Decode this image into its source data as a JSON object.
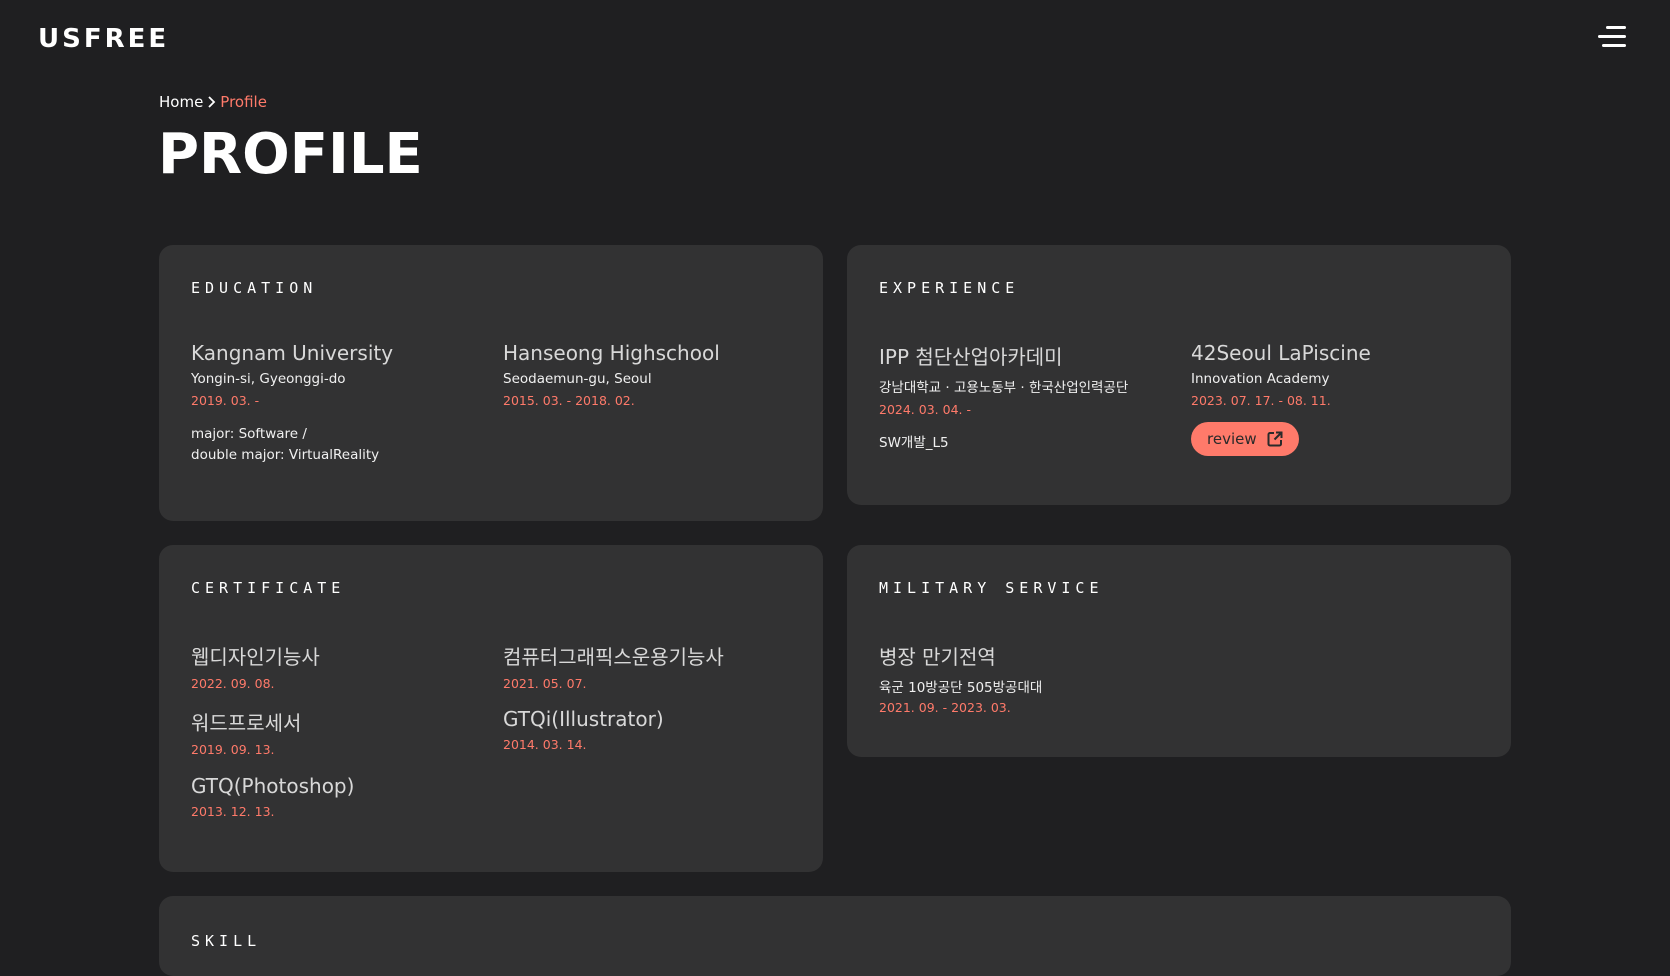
{
  "header": {
    "logo": "USFREE",
    "menu_icon": "hamburger-menu-icon"
  },
  "breadcrumb": {
    "home": "Home",
    "current": "Profile"
  },
  "page_title": "PROFILE",
  "education": {
    "title": "EDUCATION",
    "items": [
      {
        "name": "Kangnam University",
        "location": "Yongin-si, Gyeonggi-do",
        "date": "2019. 03. -",
        "note_line1": "major: Software /",
        "note_line2": "double major: VirtualReality"
      },
      {
        "name": "Hanseong Highschool",
        "location": "Seodaemun-gu, Seoul",
        "date": "2015. 03. - 2018. 02."
      }
    ]
  },
  "experience": {
    "title": "EXPERIENCE",
    "items": [
      {
        "name": "IPP 첨단산업아카데미",
        "org": "강남대학교 · 고용노동부 · 한국산업인력공단",
        "date": "2024. 03. 04. -",
        "note": "SW개발_L5"
      },
      {
        "name": "42Seoul LaPiscine",
        "org": "Innovation Academy",
        "date": "2023. 07. 17. - 08. 11.",
        "button": "review",
        "button_icon": "external-link-icon"
      }
    ]
  },
  "certificate": {
    "title": "CERTIFICATE",
    "items": [
      {
        "name": "웹디자인기능사",
        "date": "2022. 09. 08."
      },
      {
        "name": "컴퓨터그래픽스운용기능사",
        "date": "2021. 05. 07."
      },
      {
        "name": "워드프로세서",
        "date": "2019. 09. 13."
      },
      {
        "name": "GTQi(Illustrator)",
        "date": "2014. 03. 14."
      },
      {
        "name": "GTQ(Photoshop)",
        "date": "2013. 12. 13."
      }
    ]
  },
  "military": {
    "title": "MILITARY SERVICE",
    "items": [
      {
        "name": "병장 만기전역",
        "unit": "육군 10방공단 505방공대대",
        "date": "2021. 09. - 2023. 03."
      }
    ]
  },
  "skill": {
    "title": "SKILL"
  },
  "colors": {
    "background": "#1f1f21",
    "card": "#323233",
    "accent": "#ff7a6a"
  }
}
